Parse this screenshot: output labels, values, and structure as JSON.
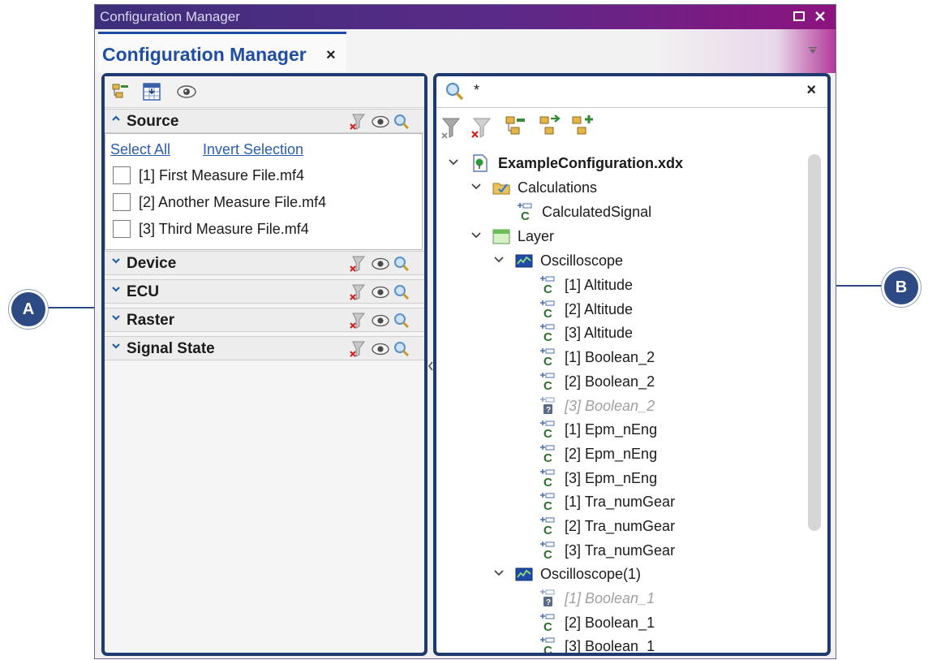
{
  "window": {
    "title": "Configuration Manager"
  },
  "tab": {
    "label": "Configuration Manager",
    "close": "×"
  },
  "callouts": {
    "a": "A",
    "b": "B"
  },
  "panel_a": {
    "sections": [
      {
        "label": "Source",
        "expanded": true
      },
      {
        "label": "Device",
        "expanded": false
      },
      {
        "label": "ECU",
        "expanded": false
      },
      {
        "label": "Raster",
        "expanded": false
      },
      {
        "label": "Signal State",
        "expanded": false
      }
    ],
    "links": {
      "select_all": "Select All",
      "invert_selection": "Invert Selection"
    },
    "files": [
      "[1] First Measure File.mf4",
      "[2] Another Measure File.mf4",
      "[3] Third Measure File.mf4"
    ]
  },
  "panel_b": {
    "search": {
      "value": "*",
      "close": "×"
    },
    "tree": {
      "root": "ExampleConfiguration.xdx",
      "calculations": "Calculations",
      "calculated_signal": "CalculatedSignal",
      "layer": "Layer",
      "oscilloscope": "Oscilloscope",
      "osc_signals": [
        {
          "label": "[1] Altitude",
          "available": true
        },
        {
          "label": "[2] Altitude",
          "available": true
        },
        {
          "label": "[3] Altitude",
          "available": true
        },
        {
          "label": "[1] Boolean_2",
          "available": true
        },
        {
          "label": "[2] Boolean_2",
          "available": true
        },
        {
          "label": "[3] Boolean_2",
          "available": false
        },
        {
          "label": "[1] Epm_nEng",
          "available": true
        },
        {
          "label": "[2] Epm_nEng",
          "available": true
        },
        {
          "label": "[3] Epm_nEng",
          "available": true
        },
        {
          "label": "[1] Tra_numGear",
          "available": true
        },
        {
          "label": "[2] Tra_numGear",
          "available": true
        },
        {
          "label": "[3] Tra_numGear",
          "available": true
        }
      ],
      "oscilloscope1": "Oscilloscope(1)",
      "osc1_signals": [
        {
          "label": "[1] Boolean_1",
          "available": false
        },
        {
          "label": "[2] Boolean_1",
          "available": true
        },
        {
          "label": "[3] Boolean_1",
          "available": true
        }
      ]
    }
  },
  "colors": {
    "accent": "#1e3a6e",
    "link": "#2a5db0",
    "title_gradient_end": "#8d137f",
    "callout": "#2d4a84"
  }
}
